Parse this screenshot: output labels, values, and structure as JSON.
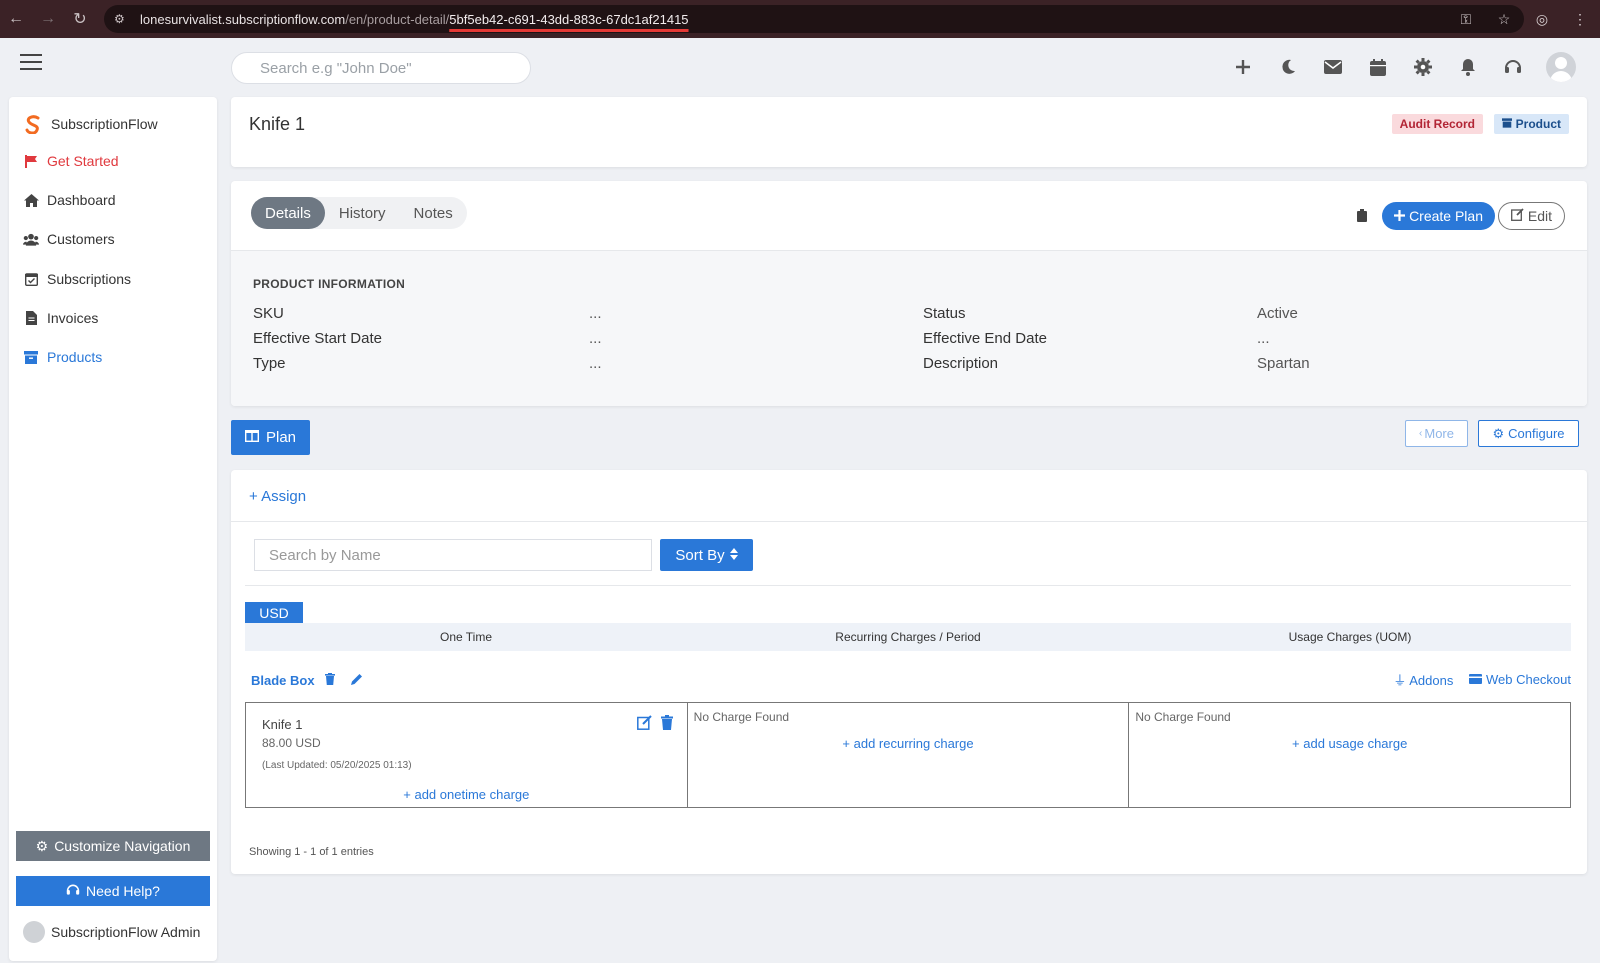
{
  "browser": {
    "url_host": "lonesurvivalist.subscriptionflow.com",
    "url_path": "/en/product-detail/",
    "url_id": "5bf5eb42-c691-43dd-883c-67dc1af21415"
  },
  "topbar": {
    "search_placeholder": "Search e.g \"John Doe\""
  },
  "sidebar": {
    "brand": "SubscriptionFlow",
    "items": [
      {
        "label": "Get Started",
        "icon": "flag-icon"
      },
      {
        "label": "Dashboard",
        "icon": "home-icon"
      },
      {
        "label": "Customers",
        "icon": "users-icon"
      },
      {
        "label": "Subscriptions",
        "icon": "calendar-check-icon"
      },
      {
        "label": "Invoices",
        "icon": "file-icon"
      },
      {
        "label": "Products",
        "icon": "archive-icon"
      }
    ],
    "customize_label": "Customize Navigation",
    "help_label": "Need Help?",
    "admin_name": "SubscriptionFlow Admin"
  },
  "header": {
    "title": "Knife 1",
    "badge_audit": "Audit Record",
    "badge_product": "Product"
  },
  "details": {
    "tabs": [
      "Details",
      "History",
      "Notes"
    ],
    "create_plan_label": "Create Plan",
    "edit_label": "Edit",
    "section_title": "PRODUCT INFORMATION",
    "fields": [
      {
        "label": "SKU",
        "value": "..."
      },
      {
        "label": "Status",
        "value": "Active"
      },
      {
        "label": "Effective Start Date",
        "value": "..."
      },
      {
        "label": "Effective End Date",
        "value": "..."
      },
      {
        "label": "Type",
        "value": "..."
      },
      {
        "label": "Description",
        "value": "Spartan"
      }
    ]
  },
  "plan_section": {
    "plan_tab": "Plan",
    "more_label": "More",
    "configure_label": "Configure",
    "assign_label": "+ Assign",
    "search_placeholder": "Search by Name",
    "sort_label": "Sort By",
    "currency": "USD",
    "columns": [
      "One Time",
      "Recurring Charges / Period",
      "Usage Charges (UOM)"
    ],
    "plan_name": "Blade Box",
    "addons_label": "Addons",
    "web_checkout_label": "Web Checkout",
    "onetime_charge": {
      "name": "Knife 1",
      "price": "88.00 USD",
      "updated": "(Last Updated: 05/20/2025 01:13)",
      "add_label": "+ add onetime charge"
    },
    "recurring": {
      "empty": "No Charge Found",
      "add_label": "+ add recurring charge"
    },
    "usage": {
      "empty": "No Charge Found",
      "add_label": "+ add usage charge"
    },
    "showing": "Showing 1 - 1 of 1 entries"
  },
  "colors": {
    "primary": "#2a78d8",
    "danger": "#e0393e",
    "muted_button": "#6e7883"
  }
}
